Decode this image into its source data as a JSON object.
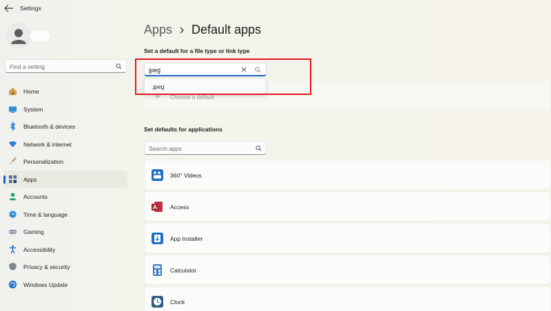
{
  "window": {
    "title": "Settings"
  },
  "sidebar": {
    "search": {
      "placeholder": "Find a setting",
      "value": ""
    },
    "items": [
      {
        "label": "Home",
        "icon": "home-icon"
      },
      {
        "label": "System",
        "icon": "system-icon"
      },
      {
        "label": "Bluetooth & devices",
        "icon": "bluetooth-icon"
      },
      {
        "label": "Network & internet",
        "icon": "wifi-icon"
      },
      {
        "label": "Personalization",
        "icon": "brush-icon"
      },
      {
        "label": "Apps",
        "icon": "apps-icon",
        "selected": true
      },
      {
        "label": "Accounts",
        "icon": "accounts-icon"
      },
      {
        "label": "Time & language",
        "icon": "globe-clock-icon"
      },
      {
        "label": "Gaming",
        "icon": "gamepad-icon"
      },
      {
        "label": "Accessibility",
        "icon": "accessibility-icon"
      },
      {
        "label": "Privacy & security",
        "icon": "shield-icon"
      },
      {
        "label": "Windows Update",
        "icon": "update-icon"
      }
    ]
  },
  "breadcrumb": {
    "parent": "Apps",
    "current": "Default apps"
  },
  "file_type": {
    "label": "Set a default for a file type or link type",
    "search_value": "jpeg",
    "suggestion": ".jpeg",
    "choose_default": "Choose a default"
  },
  "apps_section": {
    "label": "Set defaults for applications",
    "search_placeholder": "Search apps",
    "apps": [
      {
        "name": "360° Videos",
        "icon": "360-videos-icon"
      },
      {
        "name": "Access",
        "icon": "access-icon"
      },
      {
        "name": "App Installer",
        "icon": "app-installer-icon"
      },
      {
        "name": "Calculator",
        "icon": "calculator-icon"
      },
      {
        "name": "Clock",
        "icon": "clock-icon"
      }
    ]
  },
  "colors": {
    "accent": "#1a63c5",
    "highlight_box": "#e3141f"
  }
}
